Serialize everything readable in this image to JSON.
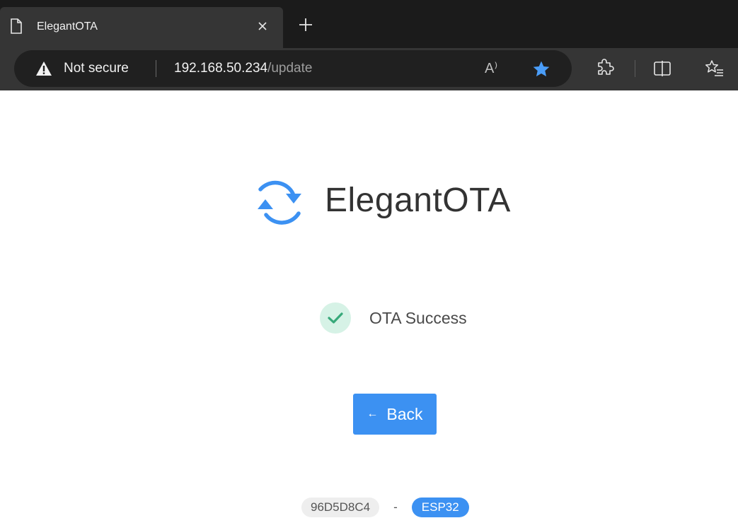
{
  "browser": {
    "tab_title": "ElegantOTA",
    "close_glyph": "×",
    "new_tab_glyph": "+",
    "security_label": "Not secure",
    "url_host": "192.168.50.234",
    "url_path": "/update",
    "read_aloud_label": "A⁾",
    "icons": [
      "page-icon",
      "close-icon",
      "plus-icon",
      "warning-icon",
      "read-aloud-icon",
      "star-icon",
      "extensions-icon",
      "split-screen-icon",
      "favorites-icon"
    ]
  },
  "page": {
    "brand_name": "ElegantOTA",
    "status_text": "OTA Success",
    "back_arrow": "←",
    "back_label": "Back",
    "hardware_id": "96D5D8C4",
    "separator": "-",
    "chip": "ESP32"
  },
  "colors": {
    "accent": "#3c91f2",
    "success_bg": "#d6f2e6",
    "success_check": "#37a97a",
    "chrome_dark": "#202124",
    "star": "#4a9df8"
  }
}
